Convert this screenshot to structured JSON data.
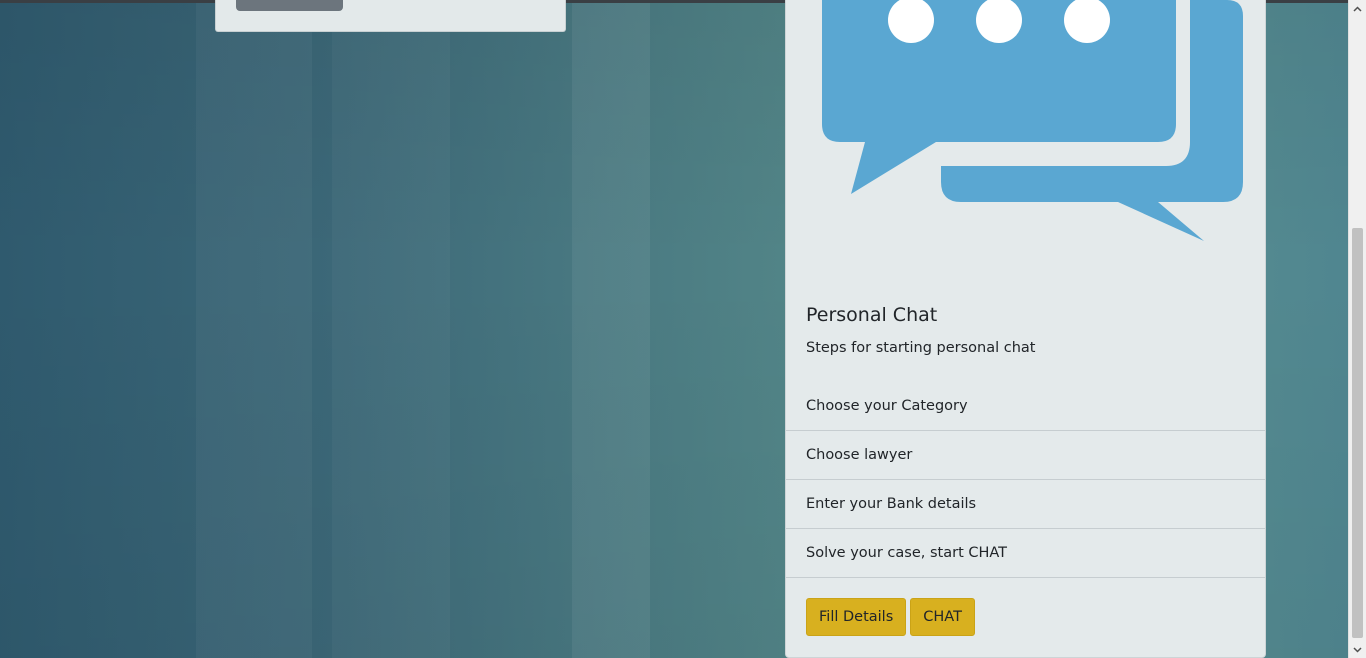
{
  "chat_card": {
    "title": "Personal Chat",
    "subtitle": "Steps for starting personal chat",
    "image_icon": "chat-bubbles-icon",
    "steps": [
      "Choose your Category",
      "Choose lawyer",
      "Enter your Bank details",
      "Solve your case, start CHAT"
    ],
    "buttons": {
      "fill_details": "Fill Details",
      "chat": "CHAT"
    }
  },
  "colors": {
    "chat_icon": "#5aa7d2",
    "button_warning": "#d8b01f",
    "card_background": "#e4eaeb"
  },
  "scrollbar": {
    "up_icon": "chevron-up-icon",
    "down_icon": "chevron-down-icon"
  }
}
